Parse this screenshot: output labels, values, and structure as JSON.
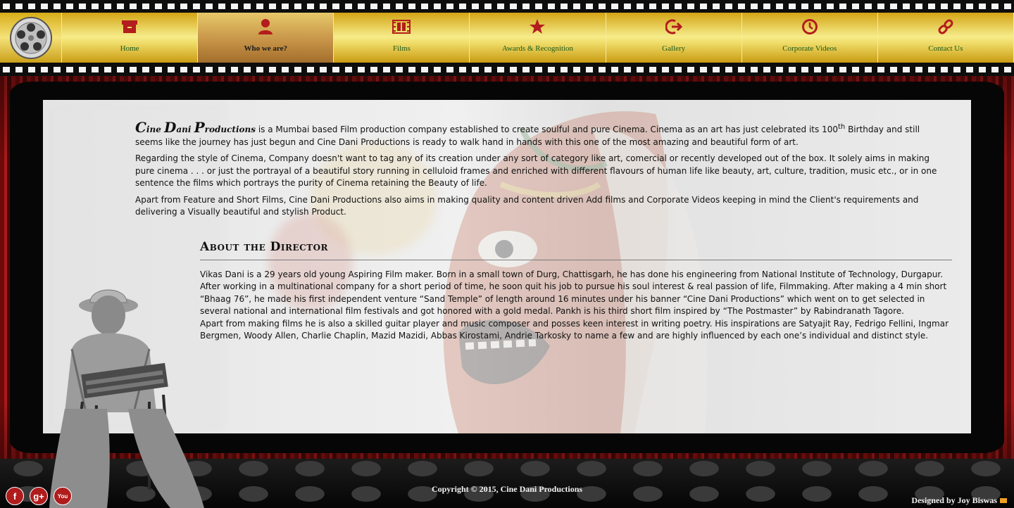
{
  "nav": {
    "items": [
      {
        "label": "Home",
        "icon": "archive-icon"
      },
      {
        "label": "Who we are?",
        "icon": "user-icon"
      },
      {
        "label": "Films",
        "icon": "film-icon"
      },
      {
        "label": "Awards & Recognition",
        "icon": "star-icon"
      },
      {
        "label": "Gallery",
        "icon": "sign-out-icon"
      },
      {
        "label": "Corporate Videos",
        "icon": "clock-icon"
      },
      {
        "label": "Contact Us",
        "icon": "link-icon"
      }
    ],
    "active_index": 1
  },
  "intro": {
    "brand_parts": [
      "C",
      "ine ",
      "D",
      "ani ",
      "P",
      "roductions"
    ],
    "p1_a": " is a Mumbai based Film production company established to create soulful and pure Cinema. Cinema as an art has just celebrated its 100",
    "p1_sup": "th",
    "p1_b": " Birthday and still seems like the journey has just begun and Cine Dani Productions is ready to walk hand in hands with this one of the most amazing and beautiful form of art.",
    "p2": "Regarding the style of Cinema, Company doesn't want to tag any of its creation under any sort of category like art, comercial or recently developed out of the box. It solely aims in making pure cinema . . . or just the portrayal of a beautiful story running in celluloid frames and enriched with different flavours of human life like beauty, art, culture, tradition, music etc., or in one sentence the films which portrays the purity of Cinema retaining the Beauty of life.",
    "p3": "Apart from Feature and Short Films, Cine Dani Productions also aims in making quality and content driven Add films and Corporate Videos keeping in mind the Client's requirements and delivering a Visually beautiful and stylish Product."
  },
  "director": {
    "title": "About the Director",
    "p1": "Vikas Dani is a 29 years old young Aspiring Film maker. Born in a small town of Durg, Chattisgarh, he has done his engineering from National Institute of Technology, Durgapur. After working in a multinational company for a short period of time, he soon quit his job to pursue his soul interest & real passion of life, Filmmaking. After making a 4 min short “Bhaag 76”, he made his first independent venture “Sand Temple” of length around 16 minutes under his banner “Cine Dani Productions” which went on to get selected in several national and international film festivals and got honored with a gold medal. Pankh is his third short film inspired by “The Postmaster” by Rabindranath Tagore.",
    "p2": "Apart from making films he is also a skilled guitar player and music composer and posses keen interest in writing poetry. His inspirations are Satyajit Ray, Fedrigo Fellini, Ingmar Bergmen, Woody Allen, Charlie Chaplin, Mazid Mazidi, Abbas Kirostami, Andrie Tarkosky to name a few and are highly influenced by each one’s individual and distinct style."
  },
  "footer": {
    "copyright": "Copyright © 2015, Cine Dani Productions",
    "designed_by": "Designed by Joy Biswas",
    "social": [
      {
        "label": "f",
        "icon": "facebook-icon"
      },
      {
        "label": "g+",
        "icon": "google-plus-icon"
      },
      {
        "label": "You",
        "icon": "youtube-icon"
      }
    ]
  },
  "colors": {
    "gold": "#e8cd4a",
    "active_tab": "#b0793a",
    "nav_text": "#1b5b1b",
    "icon_red": "#b31d1d",
    "curtain_red": "#a81b1b"
  }
}
